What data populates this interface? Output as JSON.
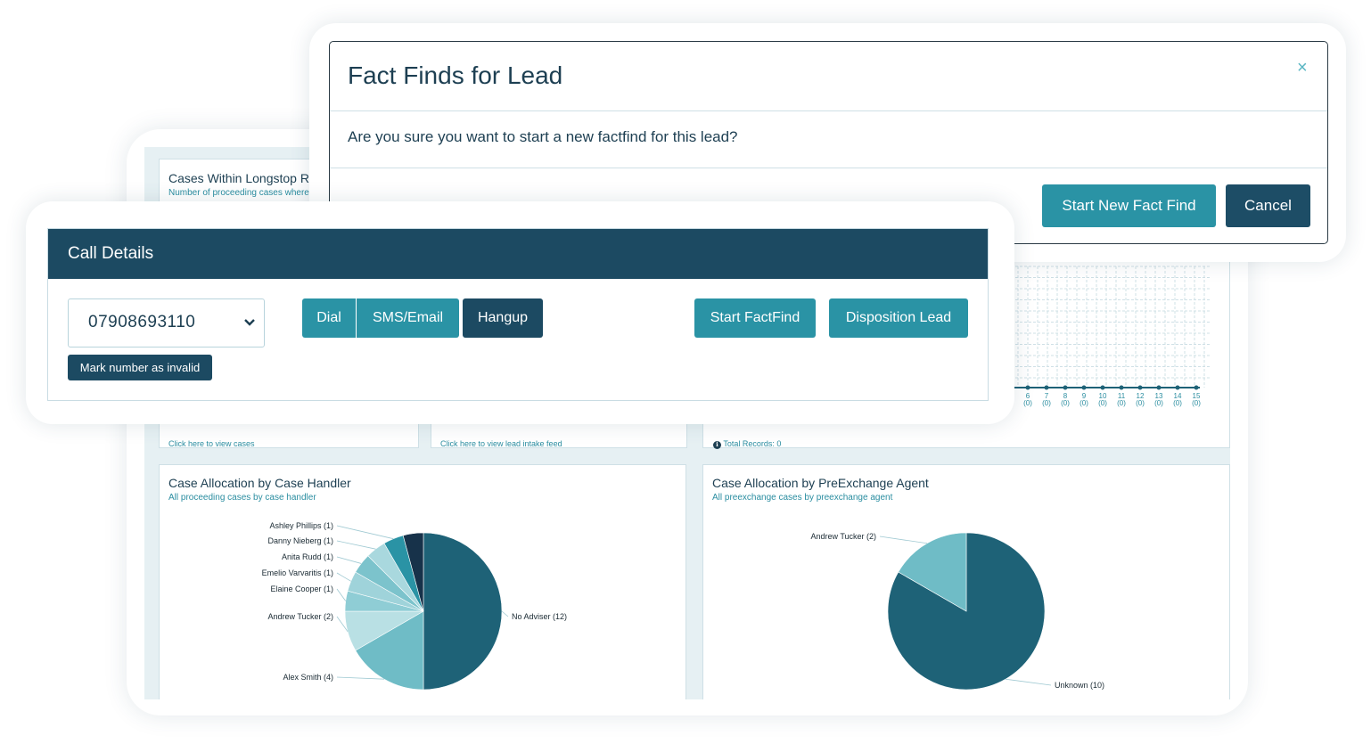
{
  "modal": {
    "title": "Fact Finds for Lead",
    "close_icon": "×",
    "question": "Are you sure you want to start a new factfind for this lead?",
    "start_button": "Start New Fact Find",
    "cancel_button": "Cancel"
  },
  "call_details": {
    "title": "Call Details",
    "phone_number": "07908693110",
    "mark_invalid": "Mark number as invalid",
    "dial": "Dial",
    "sms_email": "SMS/Email",
    "hangup": "Hangup",
    "start_factfind": "Start FactFind",
    "disposition_lead": "Disposition Lead"
  },
  "dashboard": {
    "longstop_title": "Cases Within Longstop R",
    "longstop_sub": "Number of proceeding cases where lo",
    "link_view_cases": "Click here to view cases",
    "link_lead_feed": "Click here to view lead intake feed",
    "info_icon": "ℹ",
    "total_records": "Total Records: 0",
    "handler_title": "Case Allocation by Case Handler",
    "handler_sub": "All proceeding cases by case handler",
    "agent_title": "Case Allocation by PreExchange Agent",
    "agent_sub": "All preexchange cases by preexchange agent"
  },
  "colors": {
    "dark_navy": "#1c4a62",
    "teal": "#2a93a5",
    "pie_main": "#1e6277",
    "pie_light": "#6fbcc6"
  },
  "chart_data": [
    {
      "type": "line",
      "x": [
        "6",
        "7",
        "8",
        "9",
        "10",
        "11",
        "12",
        "13",
        "14",
        "15"
      ],
      "x_counts": [
        "(0)",
        "(0)",
        "(0)",
        "(0)",
        "(0)",
        "(0)",
        "(0)",
        "(0)",
        "(0)",
        "(0)"
      ],
      "values": [
        0,
        0,
        0,
        0,
        0,
        0,
        0,
        0,
        0,
        0
      ],
      "grid": true
    },
    {
      "type": "pie",
      "title": "Case Allocation by Case Handler",
      "slices": [
        {
          "label": "No Adviser (12)",
          "value": 12,
          "color": "#1e6277"
        },
        {
          "label": "Alex Smith (4)",
          "value": 4,
          "color": "#6fbcc6"
        },
        {
          "label": "Andrew Tucker (2)",
          "value": 2,
          "color": "#b9e0e4"
        },
        {
          "label": "Elaine Cooper (1)",
          "value": 1,
          "color": "#8fcdd5"
        },
        {
          "label": "Emelio Varvaritis (1)",
          "value": 1,
          "color": "#9fd3da"
        },
        {
          "label": "Anita Rudd (1)",
          "value": 1,
          "color": "#7cc3cc"
        },
        {
          "label": "Danny Nieberg (1)",
          "value": 1,
          "color": "#a9d8de"
        },
        {
          "label": "Ashley Phillips (1)",
          "value": 1,
          "color": "#2a93a5"
        },
        {
          "label": "",
          "value": 1,
          "color": "#17324a"
        }
      ]
    },
    {
      "type": "pie",
      "title": "Case Allocation by PreExchange Agent",
      "slices": [
        {
          "label": "Unknown (10)",
          "value": 10,
          "color": "#1e6277"
        },
        {
          "label": "Andrew Tucker (2)",
          "value": 2,
          "color": "#6fbcc6"
        }
      ]
    }
  ]
}
